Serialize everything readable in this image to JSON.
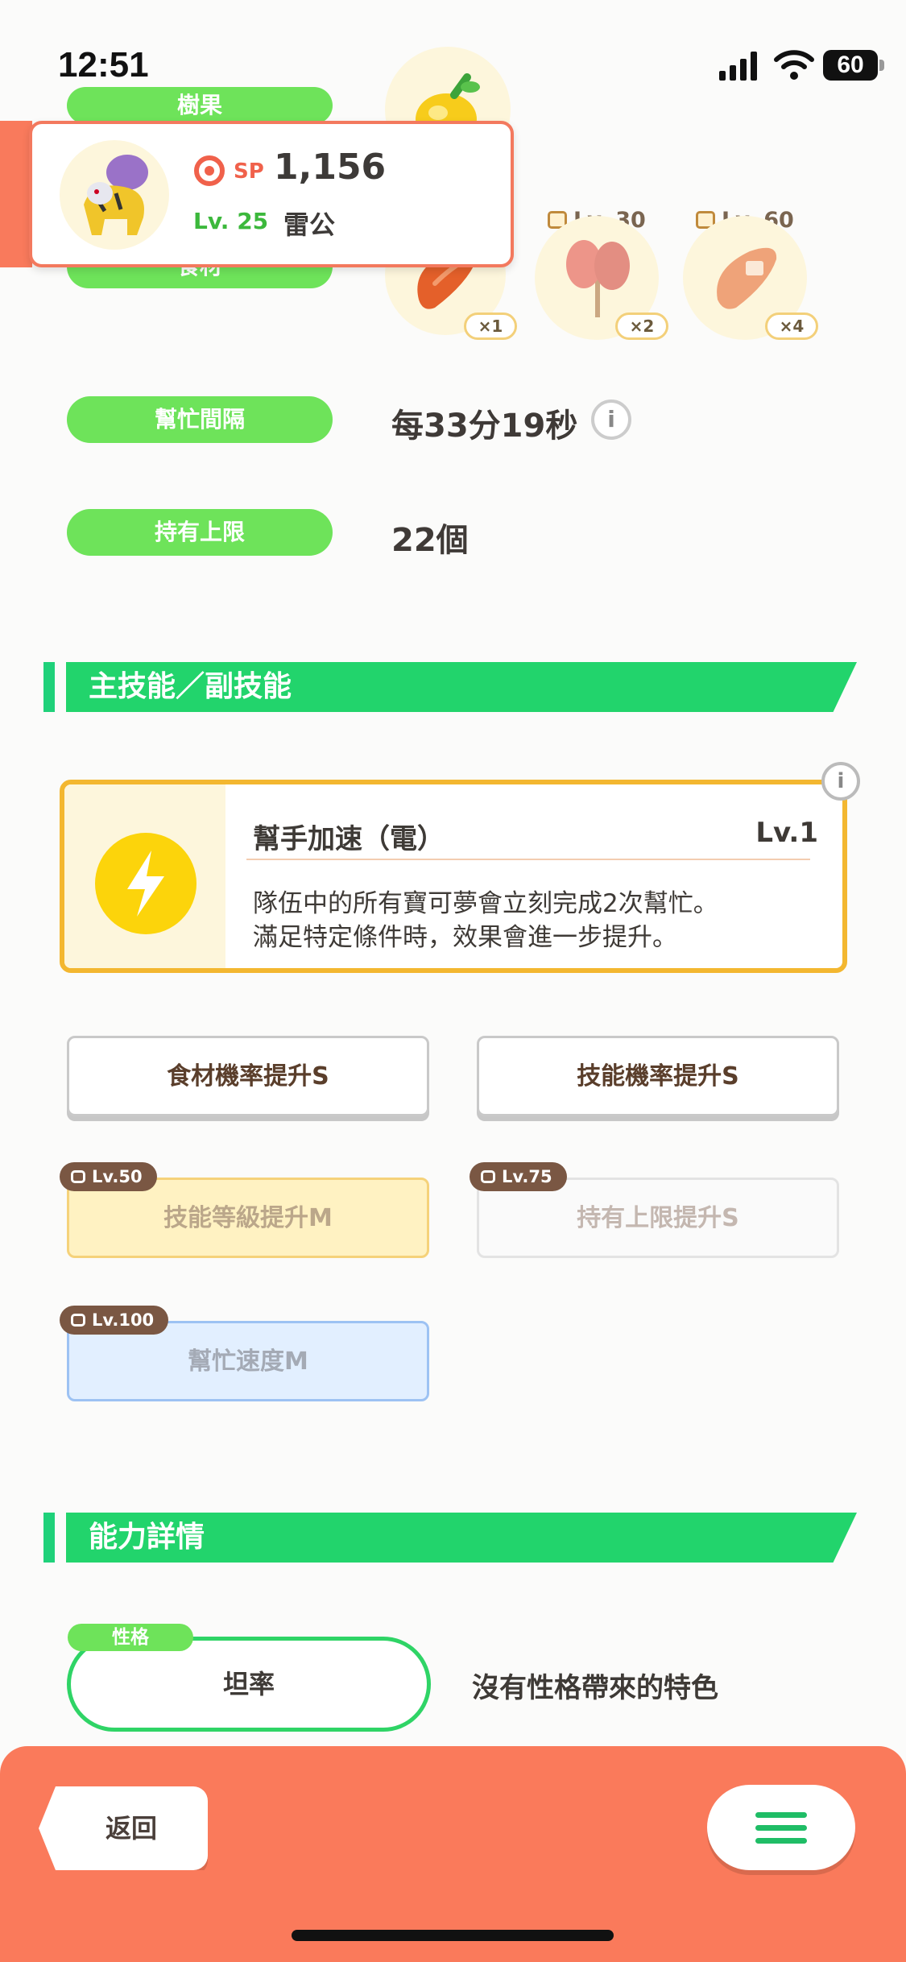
{
  "status_bar": {
    "time": "12:51",
    "battery": "60"
  },
  "profile": {
    "sp_label": "SP",
    "sp_value": "1,156",
    "level": "Lv. 25",
    "name": "雷公"
  },
  "labels": {
    "berry": "樹果",
    "ingredient": "食材",
    "help_interval": "幫忙間隔",
    "max_carry": "持有上限"
  },
  "ingredients": [
    {
      "lock_level": "",
      "qty": "×1"
    },
    {
      "lock_level": "Lv. 30",
      "qty": "×2"
    },
    {
      "lock_level": "Lv. 60",
      "qty": "×4"
    }
  ],
  "help_interval_value": "每33分19秒",
  "max_carry_value": "22個",
  "sections": {
    "skills": "主技能／副技能",
    "stats": "能力詳情"
  },
  "main_skill": {
    "name": "幫手加速（電）",
    "level": "Lv.1",
    "desc_line1": "隊伍中的所有寶可夢會立刻完成2次幫忙。",
    "desc_line2": "滿足特定條件時，效果會進一步提升。"
  },
  "sub_skills": [
    {
      "label": "食材機率提升S",
      "lock": ""
    },
    {
      "label": "技能機率提升S",
      "lock": ""
    },
    {
      "label": "技能等級提升M",
      "lock": "Lv.50"
    },
    {
      "label": "持有上限提升S",
      "lock": "Lv.75"
    },
    {
      "label": "幫忙速度M",
      "lock": "Lv.100"
    }
  ],
  "nature": {
    "tag": "性格",
    "value": "坦率",
    "desc": "沒有性格帶來的特色"
  },
  "bottom": {
    "back_label": "返回"
  },
  "colors": {
    "accent_green": "#22d46c",
    "pill_green": "#6ee35a",
    "bottom_bar": "#fa7a5b",
    "skill_border": "#f3b730"
  }
}
